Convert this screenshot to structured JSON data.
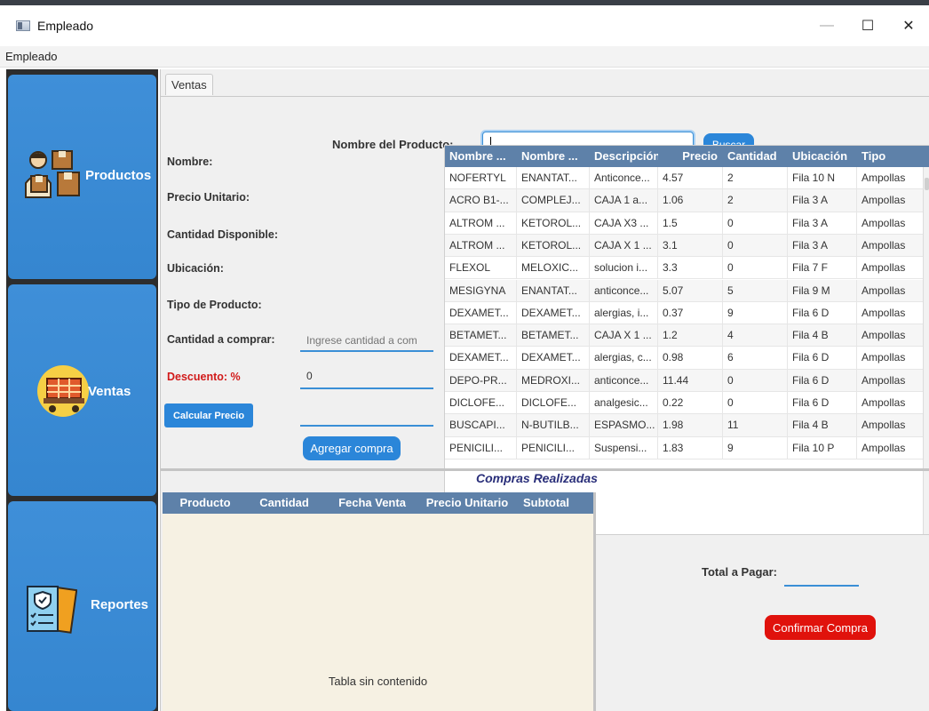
{
  "window": {
    "title": "Empleado",
    "controls": {
      "minimize": "—",
      "maximize": "☐",
      "close": "✕"
    }
  },
  "menu": {
    "items": [
      "Empleado"
    ]
  },
  "sidebar": {
    "items": [
      {
        "label": "Productos",
        "icon": "worker-boxes-icon"
      },
      {
        "label": "Ventas",
        "icon": "shopping-cart-icon"
      },
      {
        "label": "Reportes",
        "icon": "shield-checklist-icon"
      }
    ]
  },
  "tabs": [
    "Ventas"
  ],
  "search": {
    "label": "Nombre del Producto:",
    "value": "",
    "button": "Buscar"
  },
  "form": {
    "nombre": "Nombre:",
    "precio_unitario": "Precio Unitario:",
    "cantidad_disponible": "Cantidad Disponible:",
    "ubicacion": "Ubicación:",
    "tipo_producto": "Tipo de Producto:",
    "cantidad_comprar": "Cantidad a comprar:",
    "cantidad_placeholder": "Ingrese cantidad a com",
    "descuento": "Descuento: %",
    "descuento_value": "0",
    "calcular_button": "Calcular Precio",
    "agregar_button": "Agregar compra"
  },
  "products_table": {
    "columns": [
      "Nombre ...",
      "Nombre ...",
      "Descripción",
      "Precio",
      "Cantidad",
      "Ubicación",
      "Tipo"
    ],
    "rows": [
      [
        "NOFERTYL",
        "ENANTAT...",
        "Anticonce...",
        "4.57",
        "2",
        "Fila 10 N",
        "Ampollas"
      ],
      [
        "ACRO B1-...",
        "COMPLEJ...",
        "CAJA 1 a...",
        "1.06",
        "2",
        "Fila 3 A",
        "Ampollas"
      ],
      [
        "ALTROM ...",
        "KETOROL...",
        "CAJA X3 ...",
        "1.5",
        "0",
        "Fila 3 A",
        "Ampollas"
      ],
      [
        "ALTROM ...",
        "KETOROL...",
        "CAJA X 1 ...",
        "3.1",
        "0",
        "Fila 3 A",
        "Ampollas"
      ],
      [
        "FLEXOL",
        "MELOXIC...",
        "solucion i...",
        "3.3",
        "0",
        "Fila 7 F",
        "Ampollas"
      ],
      [
        "MESIGYNA",
        "ENANTAT...",
        "anticonce...",
        "5.07",
        "5",
        "Fila 9 M",
        "Ampollas"
      ],
      [
        "DEXAMET...",
        "DEXAMET...",
        "alergias, i...",
        "0.37",
        "9",
        "Fila 6 D",
        "Ampollas"
      ],
      [
        "BETAMET...",
        "BETAMET...",
        "CAJA X 1 ...",
        "1.2",
        "4",
        "Fila 4 B",
        "Ampollas"
      ],
      [
        "DEXAMET...",
        "DEXAMET...",
        "alergias, c...",
        "0.98",
        "6",
        "Fila 6 D",
        "Ampollas"
      ],
      [
        "DEPO-PR...",
        "MEDROXI...",
        "anticonce...",
        "11.44",
        "0",
        "Fila 6 D",
        "Ampollas"
      ],
      [
        "DICLOFE...",
        "DICLOFE...",
        "analgesic...",
        "0.22",
        "0",
        "Fila 6 D",
        "Ampollas"
      ],
      [
        "BUSCAPI...",
        "N-BUTILB...",
        "ESPASMO...",
        "1.98",
        "11",
        "Fila 4 B",
        "Ampollas"
      ],
      [
        "PENICILI...",
        "PENICILI...",
        "Suspensi...",
        "1.83",
        "9",
        "Fila 10 P",
        "Ampollas"
      ]
    ]
  },
  "compras": {
    "title": "Compras Realizadas",
    "columns": [
      "Producto",
      "Cantidad",
      "Fecha Venta",
      "Precio Unitario",
      "Subtotal"
    ],
    "empty_message": "Tabla sin contenido"
  },
  "total": {
    "label": "Total a Pagar:",
    "value": "",
    "confirm_button": "Confirmar Compra"
  }
}
